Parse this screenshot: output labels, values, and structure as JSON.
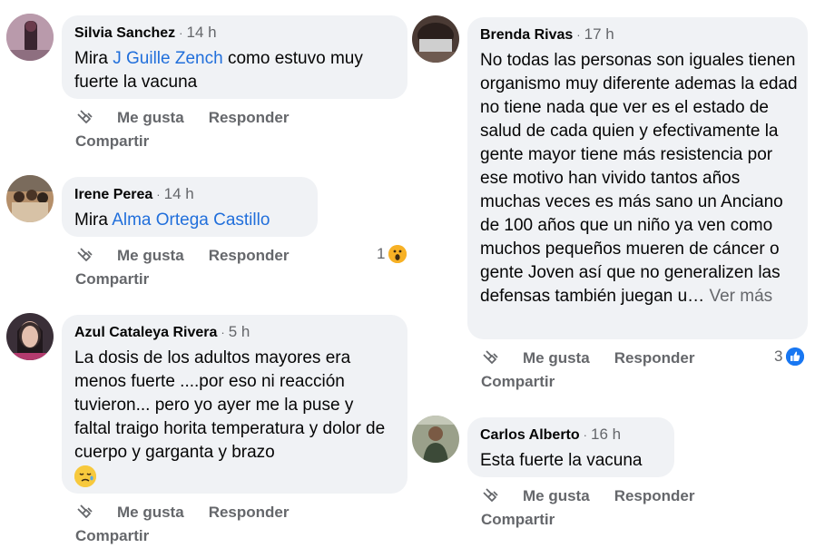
{
  "comments": [
    {
      "author": "Silvia Sanchez",
      "time": "14 h",
      "text_before": "Mira ",
      "mention": "J Guille Zench",
      "text_after": " como estuvo muy fuerte la vacuna",
      "actions": {
        "like": "Me gusta",
        "reply": "Responder",
        "share": "Compartir"
      }
    },
    {
      "author": "Irene Perea",
      "time": "14 h",
      "text_before": "Mira ",
      "mention": "Alma Ortega Castillo",
      "reaction_count": "1",
      "reaction_icon": "wow-emoji-icon",
      "actions": {
        "like": "Me gusta",
        "reply": "Responder",
        "share": "Compartir"
      }
    },
    {
      "author": "Azul Cataleya Rivera",
      "time": "5 h",
      "text": "La dosis de los adultos mayores era menos fuerte ....por eso ni reacción tuvieron... pero yo ayer me la puse y faltal traigo horita temperatura y dolor de cuerpo y garganta y brazo",
      "emoji_icon": "sad-emoji-icon",
      "actions": {
        "like": "Me gusta",
        "reply": "Responder",
        "share": "Compartir"
      }
    },
    {
      "author": "Brenda Rivas",
      "time": "17 h",
      "text": "No todas las personas son iguales tienen organismo muy diferente ademas la edad no tiene nada que ver es el estado de salud de cada quien y efectivamente la gente mayor tiene más resistencia por ese motivo han vivido tantos años muchas veces es más sano un Anciano de 100 años que un niño ya ven como muchos pequeños mueren de cáncer o gente Joven así que no generalizen las defensas también juegan u…",
      "see_more": "Ver más",
      "reaction_count": "3",
      "reaction_icon": "like-icon",
      "actions": {
        "like": "Me gusta",
        "reply": "Responder",
        "share": "Compartir"
      }
    },
    {
      "author": "Carlos Alberto",
      "time": "16 h",
      "text": "Esta fuerte la vacuna",
      "actions": {
        "like": "Me gusta",
        "reply": "Responder",
        "share": "Compartir"
      }
    }
  ],
  "separator": "·",
  "colors": {
    "bubble": "#f0f2f5",
    "link": "#216fdb",
    "meta": "#65676b"
  }
}
